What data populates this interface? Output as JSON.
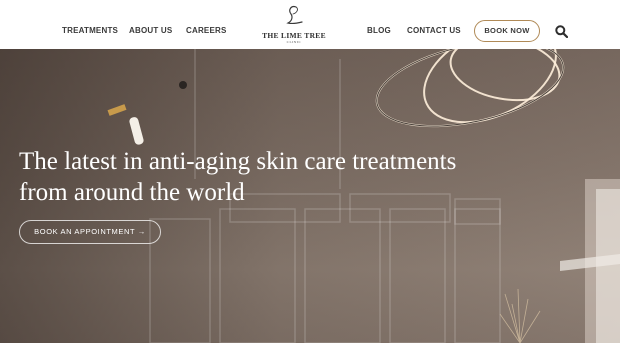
{
  "nav": {
    "treatments": "TREATMENTS",
    "about": "ABOUT US",
    "careers": "CAREERS",
    "blog": "BLOG",
    "contact": "CONTACT US"
  },
  "logo": {
    "name": "THE LIME TREE",
    "sub": "CLINIC"
  },
  "header": {
    "book_now": "BOOK NOW",
    "search_icon": "search-icon"
  },
  "hero": {
    "heading_line1": "The latest in anti-aging skin care treatments",
    "heading_line2": "from around the world",
    "cta": "BOOK AN APPOINTMENT →"
  },
  "colors": {
    "accent": "#b08a57",
    "text_dark": "#3a3a3a",
    "hero_text": "#ffffff"
  }
}
